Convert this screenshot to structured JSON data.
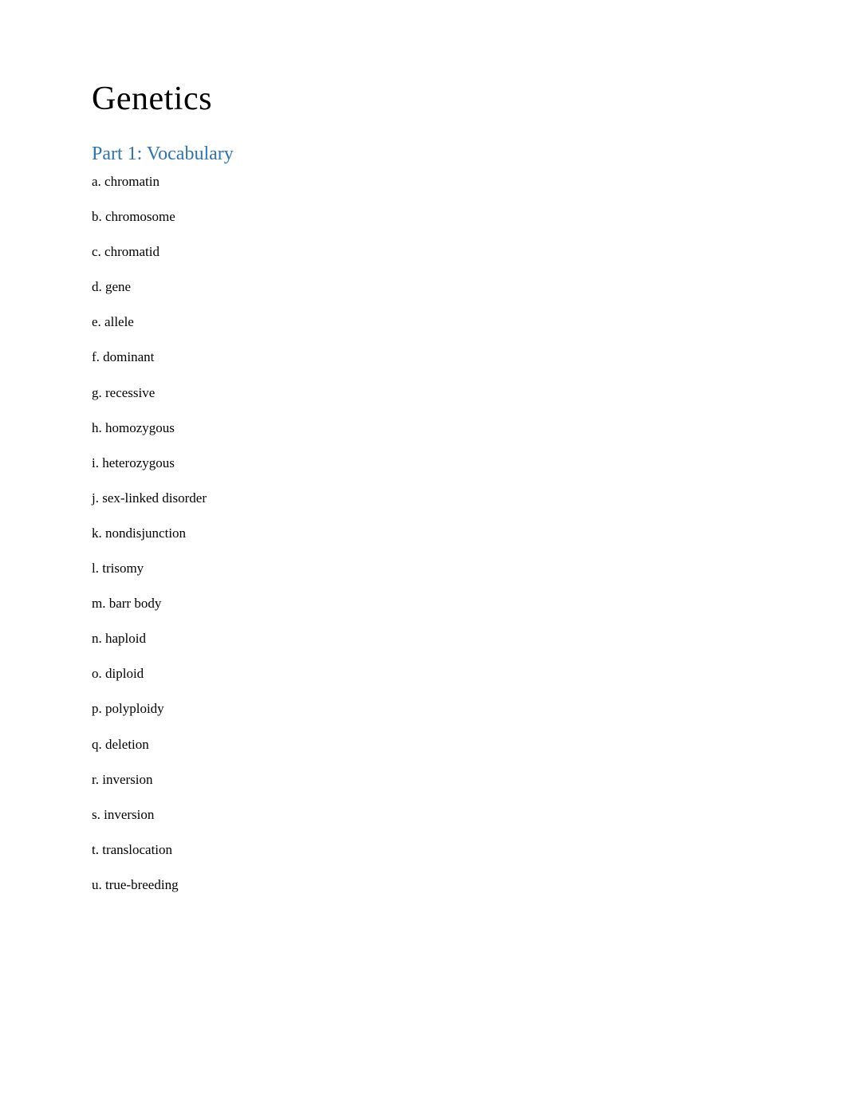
{
  "title": "Genetics",
  "section_heading": "Part 1: Vocabulary",
  "vocabulary": [
    {
      "label": "a. chromatin"
    },
    {
      "label": "b. chromosome"
    },
    {
      "label": "c. chromatid"
    },
    {
      "label": "d. gene"
    },
    {
      "label": "e. allele"
    },
    {
      "label": "f. dominant"
    },
    {
      "label": "g. recessive"
    },
    {
      "label": "h. homozygous"
    },
    {
      "label": "i. heterozygous"
    },
    {
      "label": "j. sex-linked disorder"
    },
    {
      "label": "k. nondisjunction"
    },
    {
      "label": "l. trisomy"
    },
    {
      "label": "m. barr body"
    },
    {
      "label": "n. haploid"
    },
    {
      "label": "o. diploid"
    },
    {
      "label": "p. polyploidy"
    },
    {
      "label": "q. deletion"
    },
    {
      "label": "r. inversion"
    },
    {
      "label": "s. inversion"
    },
    {
      "label": "t. translocation"
    },
    {
      "label": "u. true-breeding"
    }
  ]
}
